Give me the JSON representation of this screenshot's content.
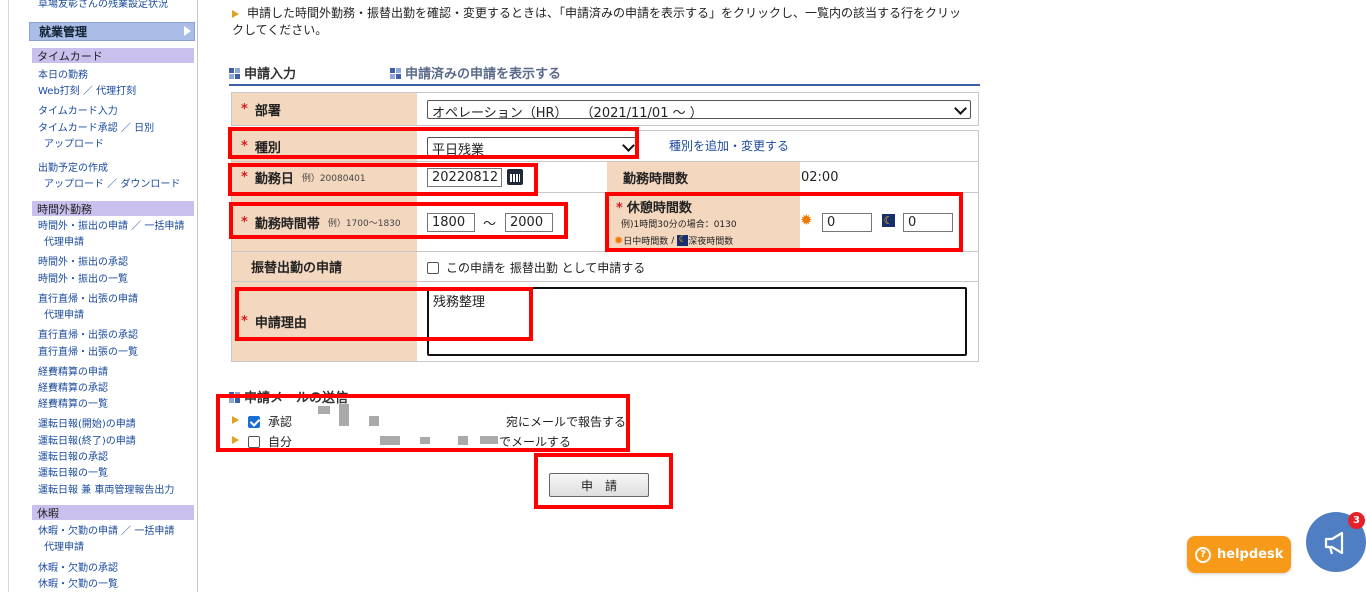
{
  "sidebar": {
    "top_link": "草場友彰さんの残業設定状況",
    "main_tab": "就業管理",
    "sections": [
      {
        "title": "タイムカード"
      },
      {
        "title": "時間外勤務"
      },
      {
        "title": "休暇"
      }
    ],
    "links": [
      "本日の勤務",
      "Web打刻 ／ 代理打刻",
      "タイムカード入力",
      "タイムカード承認 ／ 日別",
      "アップロード",
      "出勤予定の作成",
      "アップロード ／ ダウンロード",
      "時間外・振出の申請 ／ 一括申請",
      "代理申請",
      "時間外・振出の承認",
      "時間外・振出の一覧",
      "直行直帰・出張の申請",
      "代理申請",
      "直行直帰・出張の承認",
      "直行直帰・出張の一覧",
      "経費精算の申請",
      "経費精算の承認",
      "経費精算の一覧",
      "運転日報(開始)の申請",
      "運転日報(終了)の申請",
      "運転日報の承認",
      "運転日報の一覧",
      "運転日報 兼 車両管理報告出力",
      "休暇・欠勤の申請 ／ 一括申請",
      "代理申請",
      "休暇・欠勤の承認",
      "休暇・欠勤の一覧"
    ]
  },
  "notice": {
    "text": "申請した時間外勤務・振替出勤を確認・変更するときは、「申請済みの申請を表示する」をクリックし、一覧内の該当する行をクリックしてください。"
  },
  "tabs": {
    "entry": "申請入力",
    "list": "申請済みの申請を表示する"
  },
  "form": {
    "required_mark": "*",
    "department": {
      "label": "部署",
      "value": "オペレーション（HR）　　（2021/11/01 ～ ）"
    },
    "type": {
      "label": "種別",
      "value": "平日残業",
      "link": "種別を追加・変更する"
    },
    "work_date": {
      "label": "勤務日",
      "example": "例）20080401",
      "value": "20220812"
    },
    "work_hours": {
      "label": "勤務時間数",
      "value": "02:00"
    },
    "work_period": {
      "label": "勤務時間帯",
      "example": "例）1700～1830",
      "start": "1800",
      "sep": "～",
      "end": "2000"
    },
    "break_hours": {
      "label": "休憩時間数",
      "example": "例)1時間30分の場合：0130",
      "day_label": "日中時間数",
      "slash": "/",
      "night_label": "深夜時間数",
      "day_value": "0",
      "night_value": "0"
    },
    "transfer": {
      "label": "振替出勤の申請",
      "checkbox_text": "この申請を 振替出勤 として申請する",
      "checked": false
    },
    "reason": {
      "label": "申請理由",
      "value": "残務整理"
    }
  },
  "mail": {
    "title": "申請メールの送信",
    "approver_prefix": "承認",
    "approver_suffix": "宛にメールで報告する",
    "approver_checked": true,
    "self_prefix": "自分",
    "self_suffix": "でメールする",
    "self_checked": false
  },
  "submit": {
    "label": "申　請"
  },
  "helpdesk": {
    "label": "helpdesk",
    "badge": "3"
  },
  "colors": {
    "label_bg": "#f3d7bf",
    "highlight": "#ff0000",
    "tab_underline": "#3d5fa8",
    "sidebar_tab": "#a9bde6",
    "section_bg": "#c9c0ee",
    "helpdesk": "#f79a1a",
    "fab": "#4f7fc2"
  }
}
